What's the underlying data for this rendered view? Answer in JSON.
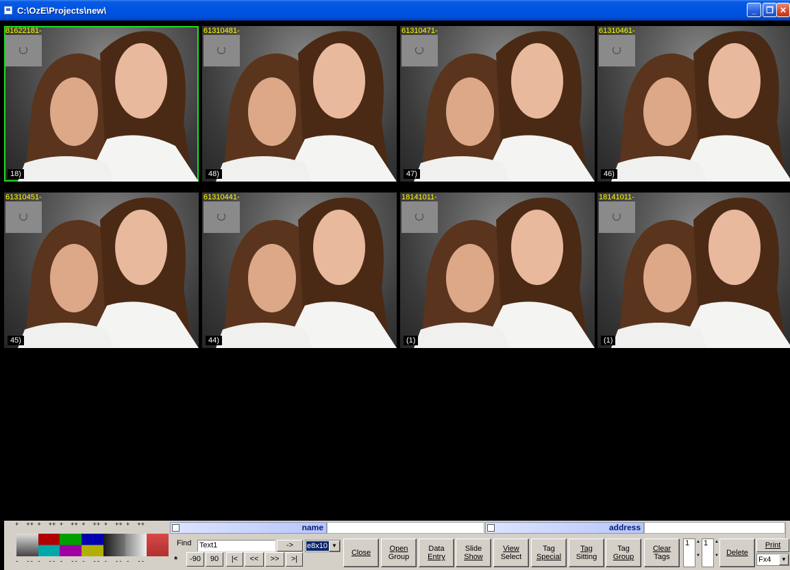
{
  "window": {
    "title": "C:\\OzE\\Projects\\new\\",
    "minimize_label": "_",
    "maximize_label": "❐",
    "close_label": "✕"
  },
  "thumbnails": [
    {
      "id": "81622181-",
      "num": "18)",
      "selected": true
    },
    {
      "id": "61310481-",
      "num": "48)",
      "selected": false
    },
    {
      "id": "61310471-",
      "num": "47)",
      "selected": false
    },
    {
      "id": "61310461-",
      "num": "46)",
      "selected": false
    },
    {
      "id": "61310451-",
      "num": "45)",
      "selected": false
    },
    {
      "id": "61310441-",
      "num": "44)",
      "selected": false
    },
    {
      "id": "18141011-",
      "num": "(1)",
      "selected": false
    },
    {
      "id": "18141011-",
      "num": "(1)",
      "selected": false
    }
  ],
  "palette": {
    "top_marks": "+  ++ +  ++ +  ++ +  ++ +  ++ +  ++",
    "bottom_marks": "-  -- -  -- -  -- -  -- -  -- -  --",
    "colors": [
      "#555555",
      "#a00000",
      "#00a000",
      "#0000b0",
      "#303030",
      "#d0d0d0",
      "#c84040"
    ]
  },
  "fields": {
    "name_label": "name",
    "address_label": "address"
  },
  "find": {
    "label": "Find",
    "value": "Text1",
    "go_label": "->",
    "size_value": "e8x10"
  },
  "nav": {
    "star": "*",
    "rot_left": "-90",
    "rot_right": "90",
    "first": "|<",
    "prev": "<<",
    "next": ">>",
    "last": ">|"
  },
  "buttons": {
    "close": {
      "l1": "Close",
      "l2": ""
    },
    "open_group": {
      "l1": "Open",
      "l2": "Group"
    },
    "data_entry": {
      "l1": "Data",
      "l2": "Entry"
    },
    "slide_show": {
      "l1": "Slide",
      "l2": "Show"
    },
    "view_select": {
      "l1": "View",
      "l2": "Select"
    },
    "tag_special": {
      "l1": "Tag",
      "l2": "Special"
    },
    "tag_sitting": {
      "l1": "Tag",
      "l2": "Sitting"
    },
    "tag_group": {
      "l1": "Tag",
      "l2": "Group"
    },
    "clear_tags": {
      "l1": "Clear",
      "l2": "Tags"
    },
    "delete": {
      "l1": "Delete",
      "l2": ""
    }
  },
  "spinners": {
    "a": "1",
    "b": "1"
  },
  "print": {
    "label": "Print",
    "format": "Fx4"
  }
}
